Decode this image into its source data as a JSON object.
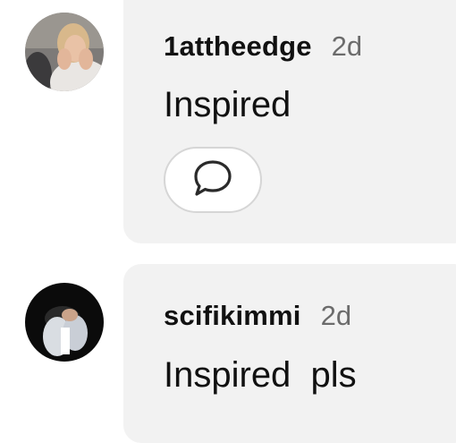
{
  "comments": [
    {
      "username": "1attheedge",
      "age": "2d",
      "text": "Inspired",
      "reply_icon": "speech-bubble-icon"
    },
    {
      "username": "scifikimmi",
      "age": "2d",
      "text": "Inspired  pls"
    }
  ]
}
